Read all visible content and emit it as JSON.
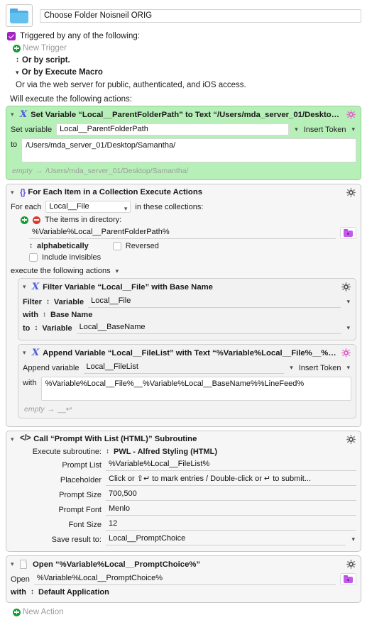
{
  "header": {
    "macro_icon": "blue-folder-icon",
    "macro_name": "Choose Folder Noisneil ORIG"
  },
  "triggers": {
    "enabled_label": "Triggered by any of the following:",
    "new_trigger_label": "New Trigger",
    "or_by_script": "Or by script.",
    "or_by_execute_macro": "Or by Execute Macro",
    "web_server_note": "Or via the web server for public, authenticated, and iOS access."
  },
  "actions_header": "Will execute the following actions:",
  "new_action_label": "New Action",
  "colors": {
    "green_action_bg": "#b7efb8",
    "gray_action_bg": "#f6f6f6",
    "purple_checkbox": "#a626c4",
    "magenta_gear": "#e060c8",
    "gray_gear": "#5a5a5a",
    "folder_blue": "#62c1ef",
    "folder_purple": "#c558ee",
    "add_green": "#0fa12f",
    "remove_red": "#dd3b30",
    "x_icon_blue": "#4a5bd6",
    "braces_purple": "#6b5cd6"
  },
  "actions": [
    {
      "id": "set-variable",
      "icon": "variable-x-icon",
      "title": "Set Variable “Local__ParentFolderPath” to Text “/Users/mda_server_01/Desktop/Samantha/”",
      "set_variable_label": "Set variable",
      "variable_name": "Local__ParentFolderPath",
      "insert_token_label": "Insert Token",
      "to_label": "to",
      "to_value": "/Users/mda_server_01/Desktop/Samantha/",
      "result_from": "empty",
      "result_to": "/Users/mda_server_01/Desktop/Samantha/"
    },
    {
      "id": "for-each",
      "icon": "braces-icon",
      "title": "For Each Item in a Collection Execute Actions",
      "for_each_label": "For each",
      "for_each_variable": "Local__File",
      "in_collections_label": "in these collections:",
      "items_in_directory_label": "The items in directory:",
      "directory_value": "%Variable%Local__ParentFolderPath%",
      "sort_order": "alphabetically",
      "reversed_label": "Reversed",
      "reversed_checked": false,
      "include_invisibles_label": "Include invisibles",
      "include_invisibles_checked": false,
      "execute_label": "execute the following actions",
      "sub_actions": [
        {
          "id": "filter-variable",
          "icon": "variable-x-icon",
          "title": "Filter Variable “Local__File” with Base Name",
          "filter_label": "Filter",
          "filter_kind": "Variable",
          "filter_value": "Local__File",
          "with_label": "with",
          "with_value": "Base Name",
          "to_label": "to",
          "to_kind": "Variable",
          "to_value": "Local__BaseName"
        },
        {
          "id": "append-variable",
          "icon": "variable-x-icon",
          "title": "Append Variable “Local__FileList” with Text “%Variable%Local__File%__%Variable%Lo...",
          "append_label": "Append variable",
          "variable_name": "Local__FileList",
          "insert_token_label": "Insert Token",
          "with_label": "with",
          "with_value": "%Variable%Local__File%__%Variable%Local__BaseName%%LineFeed%",
          "result_from": "empty",
          "result_to": "__↩"
        }
      ]
    },
    {
      "id": "call-subroutine",
      "icon": "code-tags-icon",
      "title": "Call “Prompt With List (HTML)” Subroutine",
      "fields": [
        {
          "label": "Execute subroutine:",
          "value": "PWL - Alfred Styling (HTML)",
          "kind": "stepper"
        },
        {
          "label": "Prompt List",
          "value": "%Variable%Local__FileList%",
          "kind": "text"
        },
        {
          "label": "Placeholder",
          "value": "Click or ⇧↵ to mark entries / Double-click or ↵ to submit...",
          "kind": "text"
        },
        {
          "label": "Prompt Size",
          "value": "700,500",
          "kind": "text"
        },
        {
          "label": "Prompt Font",
          "value": "Menlo",
          "kind": "text"
        },
        {
          "label": "Font Size",
          "value": "12",
          "kind": "text"
        },
        {
          "label": "Save result to:",
          "value": "Local__PromptChoice",
          "kind": "combo"
        }
      ]
    },
    {
      "id": "open-file",
      "icon": "document-icon",
      "title": "Open “%Variable%Local__PromptChoice%”",
      "open_label": "Open",
      "open_value": "%Variable%Local__PromptChoice%",
      "with_label": "with",
      "with_value": "Default Application"
    }
  ]
}
